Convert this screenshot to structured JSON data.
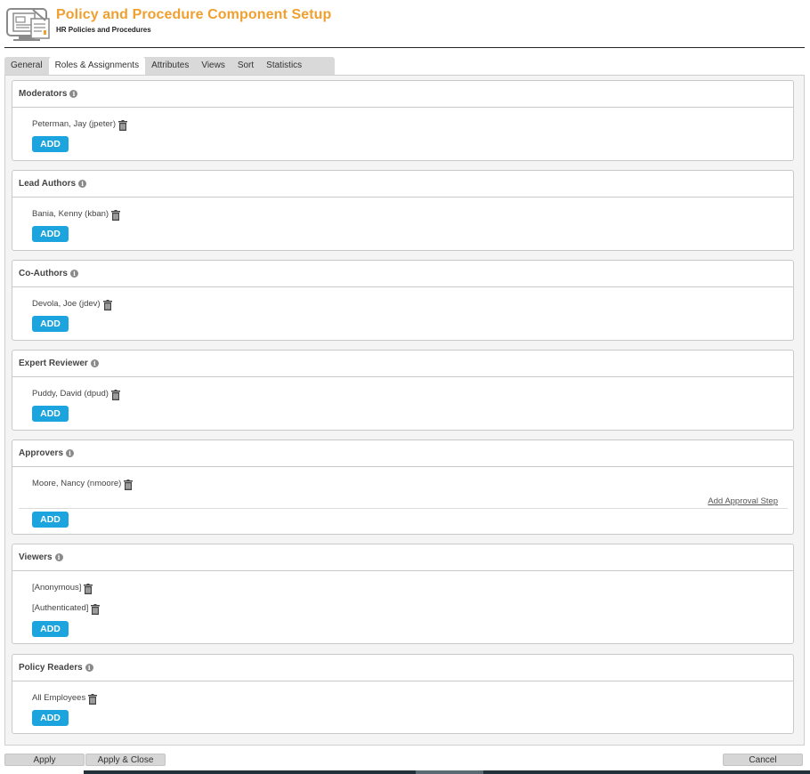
{
  "header": {
    "title": "Policy and Procedure Component Setup",
    "subtitle": "HR Policies and Procedures",
    "icon": "policy-document-icon"
  },
  "tabs": [
    {
      "label": "General",
      "active": false
    },
    {
      "label": "Roles & Assignments",
      "active": true
    },
    {
      "label": "Attributes",
      "active": false
    },
    {
      "label": "Views",
      "active": false
    },
    {
      "label": "Sort",
      "active": false
    },
    {
      "label": "Statistics",
      "active": false
    }
  ],
  "sections": {
    "moderators": {
      "title": "Moderators",
      "members": [
        "Peterman, Jay (jpeter)"
      ],
      "add_label": "ADD"
    },
    "lead_authors": {
      "title": "Lead Authors",
      "members": [
        "Bania, Kenny (kban)"
      ],
      "add_label": "ADD"
    },
    "co_authors": {
      "title": "Co-Authors",
      "members": [
        "Devola, Joe (jdev)"
      ],
      "add_label": "ADD"
    },
    "expert_reviewer": {
      "title": "Expert Reviewer",
      "members": [
        "Puddy, David (dpud)"
      ],
      "add_label": "ADD"
    },
    "approvers": {
      "title": "Approvers",
      "members": [
        "Moore, Nancy (nmoore)"
      ],
      "add_step_label": "Add Approval Step",
      "add_label": "ADD"
    },
    "viewers": {
      "title": "Viewers",
      "members": [
        "[Anonymous]",
        "[Authenticated]"
      ],
      "add_label": "ADD"
    },
    "policy_readers": {
      "title": "Policy Readers",
      "members": [
        "All Employees"
      ],
      "add_label": "ADD"
    }
  },
  "footer": {
    "apply_label": "Apply",
    "apply_close_label": "Apply & Close",
    "cancel_label": "Cancel"
  },
  "colors": {
    "title": "#f0a030",
    "add_button": "#1ba4dd",
    "tab_bar": "#d9d9d9"
  }
}
